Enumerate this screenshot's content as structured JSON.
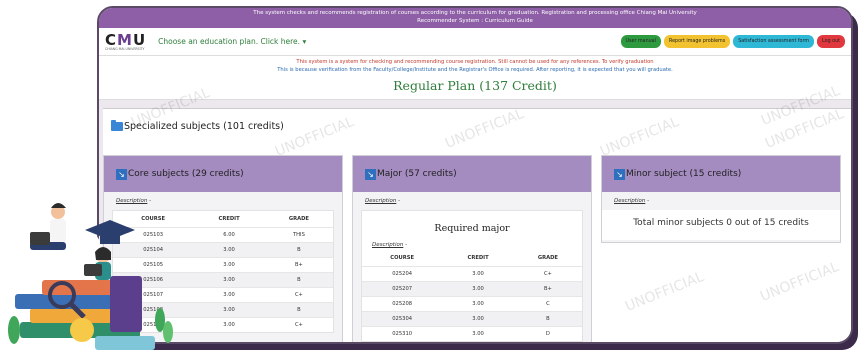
{
  "topbar": {
    "line1": "The system checks and recommends registration of courses according to the curriculum for graduation. Registration and processing office Chiang Mai University",
    "line2": "Recommender System : Curriculum Guide"
  },
  "logo": {
    "text_c": "C",
    "text_m": "M",
    "text_u": "U",
    "subtitle": "CHIANG MAI UNIVERSITY"
  },
  "nav": {
    "plan_select": "Choose an education plan. Click here.",
    "buttons": [
      {
        "label": "User manual",
        "color": "#2e9a40"
      },
      {
        "label": "Report image problems",
        "color": "#f2c230"
      },
      {
        "label": "Satisfaction assessment form",
        "color": "#2fb7d6"
      },
      {
        "label": "Log out",
        "color": "#e0383e"
      }
    ]
  },
  "notice": {
    "line1": "This system is a system for checking and recommending course registration. Still cannot be used for any references. To verify graduation",
    "line2": "This is because verification from the Faculty/College/Institute and the Registrar's Office is required. After reporting, it is expected that you will graduate."
  },
  "plan_title": "Regular Plan (137 Credit)",
  "section": {
    "title": "Specialized subjects (101 credits)"
  },
  "watermark": "UNOFFICIAL",
  "core": {
    "title": "Core subjects (29 credits)",
    "description": "Description",
    "desc_suffix": " -",
    "columns": [
      "COURSE",
      "CREDIT",
      "GRADE"
    ],
    "rows": [
      [
        "025103",
        "6.00",
        "THIS"
      ],
      [
        "025104",
        "3.00",
        "B"
      ],
      [
        "025105",
        "3.00",
        "B+"
      ],
      [
        "025106",
        "3.00",
        "B"
      ],
      [
        "025107",
        "3.00",
        "C+"
      ],
      [
        "025108",
        "3.00",
        "B"
      ],
      [
        "025109",
        "3.00",
        "C+"
      ]
    ]
  },
  "major": {
    "title": "Major (57 credits)",
    "description": "Description",
    "desc_suffix": " -",
    "required_title": "Required major",
    "columns": [
      "COURSE",
      "CREDIT",
      "GRADE"
    ],
    "rows": [
      [
        "025204",
        "3.00",
        "C+"
      ],
      [
        "025207",
        "3.00",
        "B+"
      ],
      [
        "025208",
        "3.00",
        "C"
      ],
      [
        "025304",
        "3.00",
        "B"
      ],
      [
        "025310",
        "3.00",
        "D"
      ]
    ]
  },
  "minor": {
    "title": "Minor subject (15 credits)",
    "description": "Description",
    "desc_suffix": " -",
    "total": "Total minor subjects 0 out of 15 credits"
  }
}
